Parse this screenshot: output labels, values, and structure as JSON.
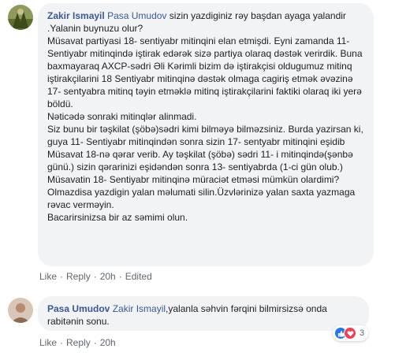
{
  "comments": [
    {
      "author": "Zakir Ismayil",
      "mention": "Pasa Umudov",
      "text_after_mention": " sizin yazdiginiz rəy başdan ayaga yalandir .Yalanin buynuzu olur?\nMüsavat partiyasi 18- sentiyabr mitinqini elan etmişdi. Eyni zamanda 11- Sentiyabr mitinqində iştirak edərək sizə partiya olaraq dəstək verirdik. Buna baxmayaraq AXCP-sədri Əli Kərimli bizim də iştirakçisi oldugumuz mitinq iştirakçilarini 18 Sentiyabr mitinqinə dəstək olmaga cagiriş etmək əvəzinə 17- sentyabra mitinq təyin etməklə mitinq iştirakçilarini faktiki olaraq iki yerə böldü.\nNəticədə sonraki mitinqlər alinmadi.\nSiz bunu bir təşkilat (şöbə)sədri kimi bilməyə bilməzsiniz. Burda yazirsan ki, guya 11- Sentiyabr mitinqindən sonra sizin 17- sentyabr mitinqini eşidib Müsavat 18-nə qərar verib. Ay təşkilat (şöbə) sədri 11- i mitinqində(şənbə günü.) sizin qərarinizi eşidəndən sonra 13- sentiyabrda (1-ci gün olub.) Müsavatin 18- Sentiyabr mitinqinə müraciət etməsi mümkün olardimi? Olmazdisa yazdigin yalan məlumati silin.Üzvlərinizə yalan saxta yazmaga rəvac verməyin.\nBacarirsinizsa bir az səmimi olun.",
      "actions": {
        "like": "Like",
        "reply": "Reply",
        "time": "20h",
        "edited": "Edited"
      },
      "avatar_color": "#6b7a3a"
    },
    {
      "author": "Pasa Umudov",
      "mention": "Zakir Ismayil",
      "text_after_mention": ",yalanla səhvin fərqini bilmirsizsə onda rabitənin sonu.",
      "actions": {
        "like": "Like",
        "reply": "Reply",
        "time": "20h"
      },
      "reactions": {
        "icons": [
          "like-icon",
          "love-icon"
        ],
        "count": "3",
        "like_color": "#2078f4",
        "love_color": "#f33e58"
      },
      "avatar_color": "#c9a58e"
    }
  ],
  "separator": "·"
}
